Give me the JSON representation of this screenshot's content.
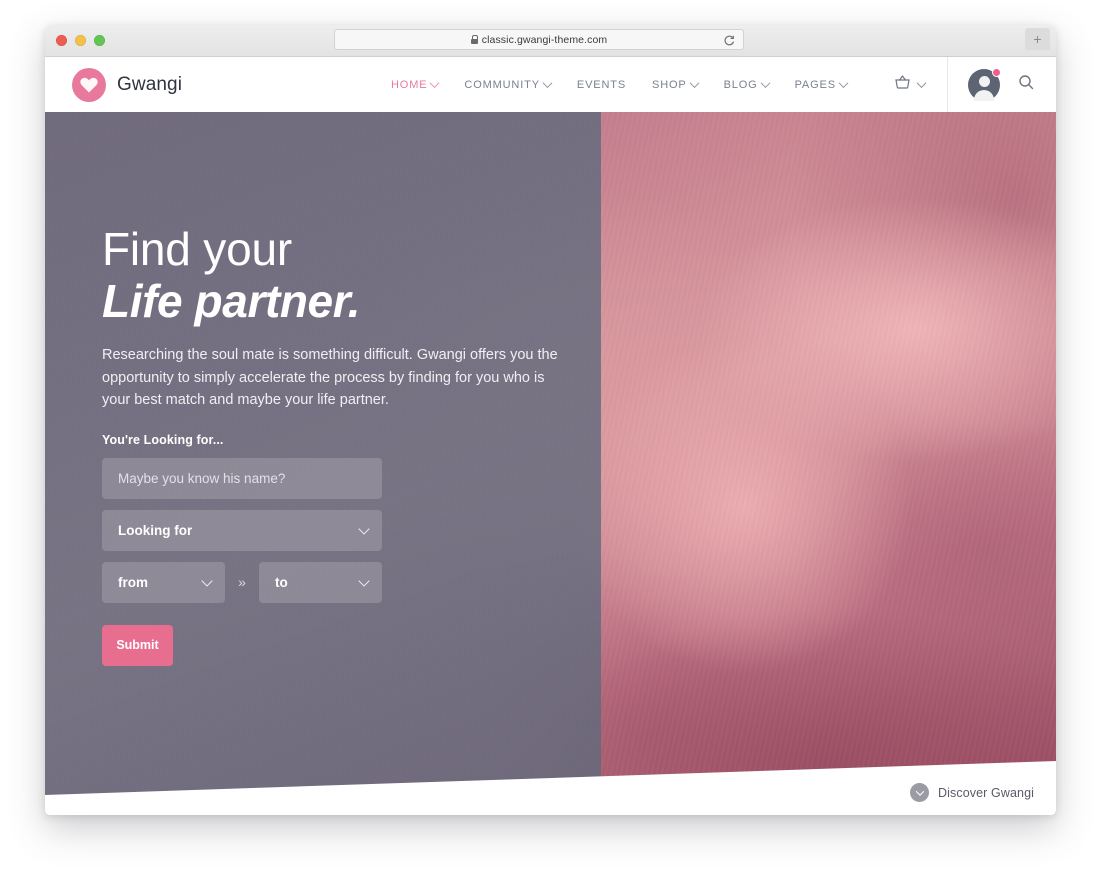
{
  "browser": {
    "url": "classic.gwangi-theme.com",
    "lock_icon": "lock-icon",
    "reload_icon": "reload-icon",
    "new_tab_label": "+",
    "traffic_lights": [
      "close-red",
      "minimize-yellow",
      "zoom-green"
    ]
  },
  "header": {
    "brand_name": "Gwangi",
    "logo_icon": "heart-logo-icon",
    "nav": [
      {
        "label": "HOME",
        "active": true,
        "has_caret": true
      },
      {
        "label": "COMMUNITY",
        "active": false,
        "has_caret": true
      },
      {
        "label": "EVENTS",
        "active": false,
        "has_caret": false
      },
      {
        "label": "SHOP",
        "active": false,
        "has_caret": true
      },
      {
        "label": "BLOG",
        "active": false,
        "has_caret": true
      },
      {
        "label": "PAGES",
        "active": false,
        "has_caret": true
      }
    ],
    "cart_icon": "shopping-basket-icon",
    "cart_caret_icon": "chevron-down-icon",
    "avatar_icon": "user-avatar-icon",
    "notification_badge": "notification-dot",
    "search_icon": "search-icon"
  },
  "hero": {
    "title_line1": "Find your",
    "title_line2": "Life partner.",
    "description": "Researching the soul mate is something difficult. Gwangi offers you the opportunity to simply accelerate the process by finding for you who is your best match and maybe your life partner.",
    "form": {
      "label": "You're Looking for...",
      "name_placeholder": "Maybe you know his name?",
      "name_value": "",
      "looking_for_value": "Looking for",
      "age_from_value": "from",
      "age_to_value": "to",
      "range_separator": "»",
      "submit_label": "Submit",
      "caret_icon": "chevron-down-icon"
    },
    "discover": {
      "label": "Discover Gwangi",
      "icon": "chevron-down-circle-icon"
    },
    "image_alt": "couple-embracing-photo"
  },
  "colors": {
    "accent_pink": "#e8799c",
    "submit_pink": "#e86e90",
    "overlay_gray": "#68687c",
    "brand_text": "#2f3440",
    "nav_text": "#7a8190"
  }
}
